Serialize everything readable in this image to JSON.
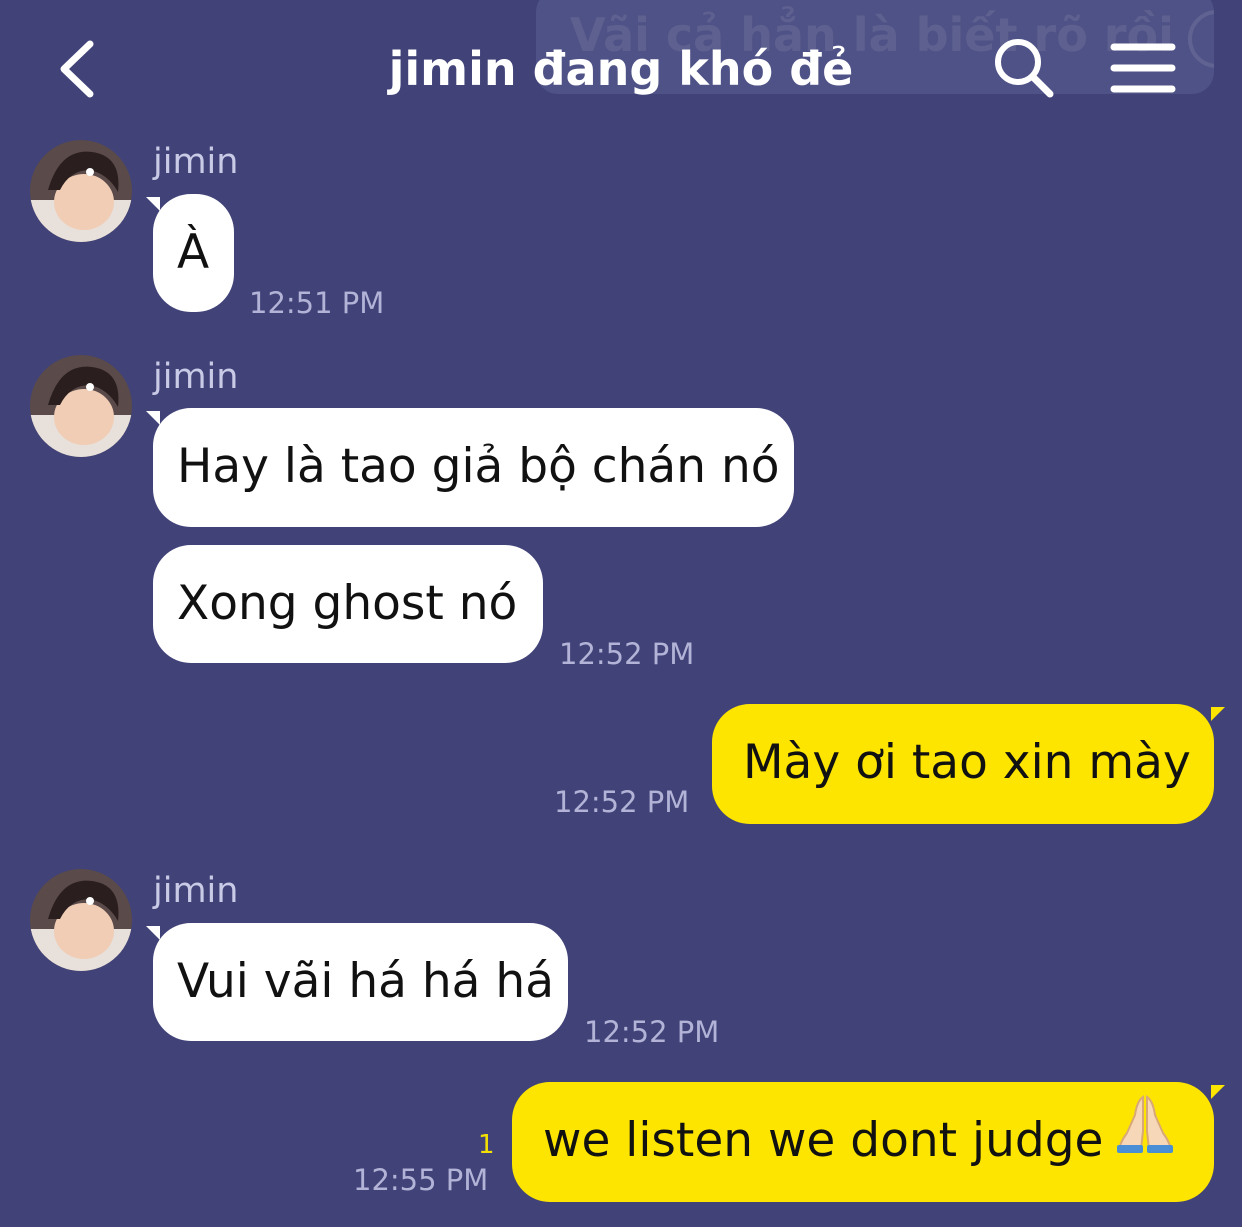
{
  "header": {
    "title": "jimin đang khó đẻ",
    "back_icon": "chevron-left-icon",
    "search_icon": "search-icon",
    "menu_icon": "hamburger-menu-icon"
  },
  "notification_preview": {
    "text": "Vãi cả hẳn là biết rõ rồi"
  },
  "colors": {
    "background": "#404278",
    "incoming_bubble": "#ffffff",
    "outgoing_bubble": "#fde500",
    "timestamp": "#b2b3d6",
    "read_count": "#f3e000"
  },
  "messages": [
    {
      "sender": "jimin",
      "direction": "incoming",
      "text": "À",
      "time": "12:51 PM"
    },
    {
      "sender": "jimin",
      "direction": "incoming",
      "text": "Hay là tao giả bộ chán nó",
      "time": ""
    },
    {
      "sender": "",
      "direction": "incoming",
      "text": "Xong ghost nó",
      "time": "12:52 PM"
    },
    {
      "sender": "",
      "direction": "outgoing",
      "text": "Mày ơi tao xin mày",
      "time": "12:52 PM"
    },
    {
      "sender": "jimin",
      "direction": "incoming",
      "text": "Vui vãi há há há",
      "time": "12:52 PM"
    },
    {
      "sender": "",
      "direction": "outgoing",
      "text": "we listen we dont judge",
      "time": "12:55 PM",
      "unread_count": "1",
      "emoji": "folded-hands-icon"
    }
  ]
}
